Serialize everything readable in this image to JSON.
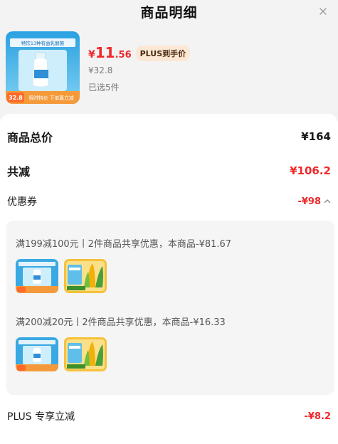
{
  "header": {
    "title": "商品明细"
  },
  "product": {
    "currency": "¥",
    "price_int": "11",
    "price_dec": ".56",
    "plus_badge": "PLUS到手价",
    "original_price": "¥32.8",
    "selected_count": "已选5件",
    "image_price_tag": "32.8",
    "image_promo_text": "限时特价 下单赢立减",
    "image_banner_text": "特饮13种有益乳酸菌"
  },
  "summary": {
    "total_label": "商品总价",
    "total_value": "¥164",
    "reduce_label": "共减",
    "reduce_value": "¥106.2",
    "coupon_label": "优惠券",
    "coupon_value": "-¥98"
  },
  "coupons": [
    {
      "text": "满199减100元丨2件商品共享优惠，本商品-¥81.67"
    },
    {
      "text": "满200减20元丨2件商品共享优惠，本商品-¥16.33"
    }
  ],
  "plus": {
    "label": "PLUS 专享立减",
    "value": "-¥8.2"
  },
  "colors": {
    "accent_red": "#f0292b",
    "plus_badge_bg": "#fbe7d3",
    "yogurt_blue": "#39a7e0",
    "corn_yellow": "#f6c13a"
  }
}
